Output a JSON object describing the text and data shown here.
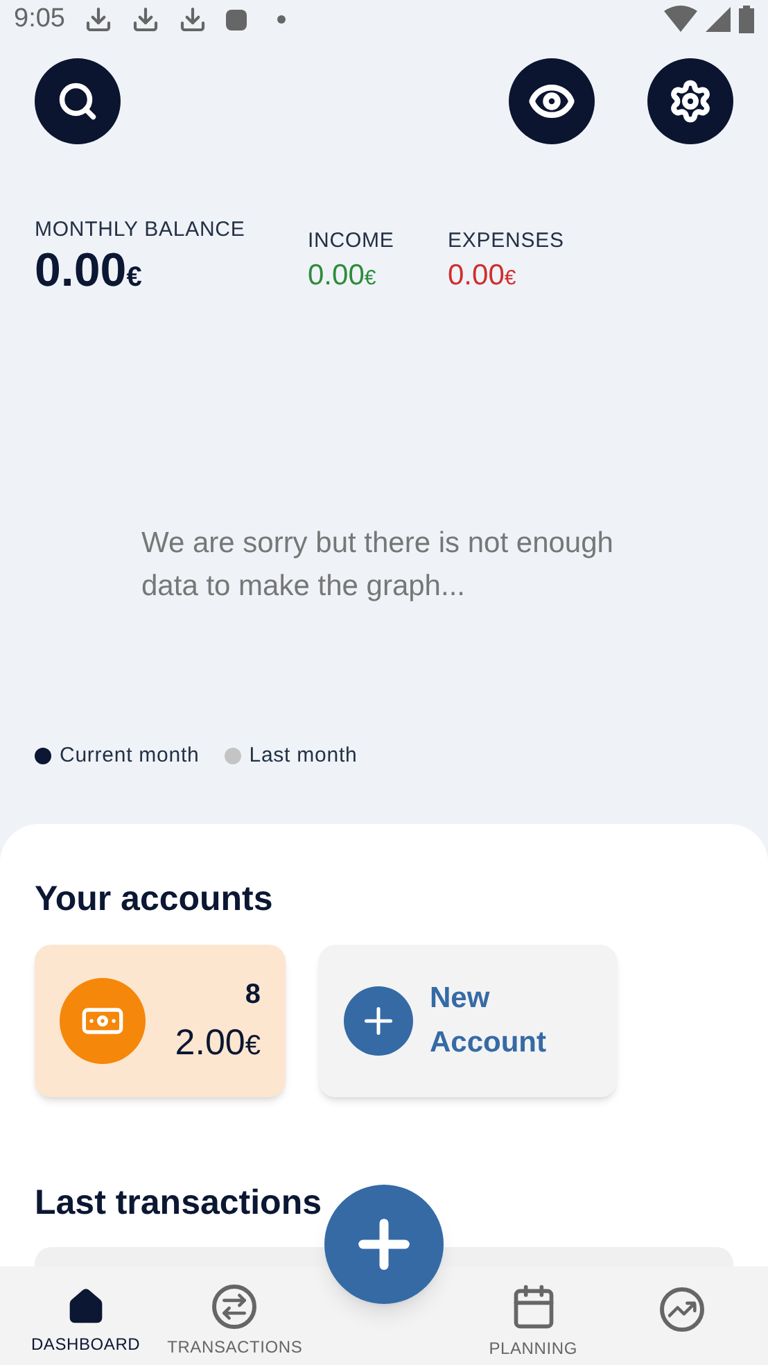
{
  "status_bar": {
    "time": "9:05"
  },
  "balance": {
    "label": "MONTHLY BALANCE",
    "amount": "0.00",
    "currency": "€"
  },
  "income": {
    "label": "INCOME",
    "amount": "0.00",
    "currency": "€"
  },
  "expenses": {
    "label": "EXPENSES",
    "amount": "0.00",
    "currency": "€"
  },
  "graph": {
    "message": "We are sorry but there is not enough data to make the graph..."
  },
  "legend": [
    {
      "label": "Current month",
      "color": "#0b1733"
    },
    {
      "label": "Last month",
      "color": "#c4c4c4"
    }
  ],
  "accounts": {
    "title": "Your accounts",
    "items": [
      {
        "kind": "account",
        "count": "8",
        "amount": "2.00",
        "currency": "€"
      },
      {
        "kind": "new",
        "label": "New Account"
      }
    ]
  },
  "transactions": {
    "title": "Last transactions"
  },
  "nav": [
    {
      "kind": "home",
      "label": "DASHBOARD",
      "selected": true
    },
    {
      "kind": "transfer",
      "label": "TRANSACTIONS",
      "selected": false
    },
    {
      "kind": "gap"
    },
    {
      "kind": "calendar",
      "label": "PLANNING",
      "selected": false
    },
    {
      "kind": "chart",
      "selected": false
    }
  ]
}
